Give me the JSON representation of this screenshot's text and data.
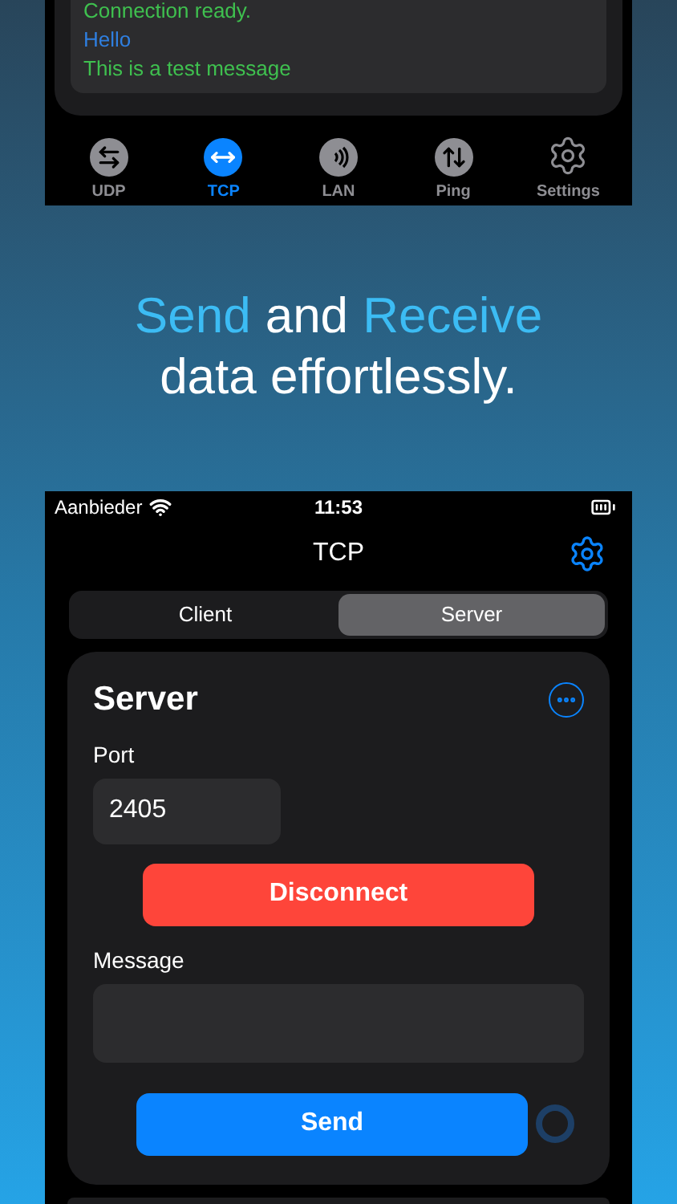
{
  "top_screen": {
    "log": [
      {
        "text": "Connection ready.",
        "kind": "status"
      },
      {
        "text": "Hello",
        "kind": "sent"
      },
      {
        "text": "This is a test message",
        "kind": "status"
      }
    ],
    "tab_bar": [
      {
        "label": "UDP",
        "kind": "swap",
        "selected": false
      },
      {
        "label": "TCP",
        "kind": "horizontal",
        "selected": true
      },
      {
        "label": "LAN",
        "kind": "waves",
        "selected": false
      },
      {
        "label": "Ping",
        "kind": "updown",
        "selected": false
      },
      {
        "label": "Settings",
        "kind": "gear",
        "selected": false
      }
    ]
  },
  "headline": {
    "line_1": [
      {
        "text": "Send",
        "highlight": true
      },
      {
        "text": "and",
        "highlight": false
      },
      {
        "text": "Receive",
        "highlight": true
      }
    ],
    "line_2": "data effortlessly."
  },
  "bottom_screen": {
    "status_bar": {
      "carrier": "Aanbieder",
      "time": "11:53"
    },
    "nav_title": "TCP",
    "segments": [
      {
        "label": "Client",
        "selected": false
      },
      {
        "label": "Server",
        "selected": true
      }
    ],
    "card": {
      "title": "Server",
      "port_label": "Port",
      "port_value": "2405",
      "disconnect": "Disconnect",
      "message_label": "Message",
      "send": "Send"
    }
  }
}
